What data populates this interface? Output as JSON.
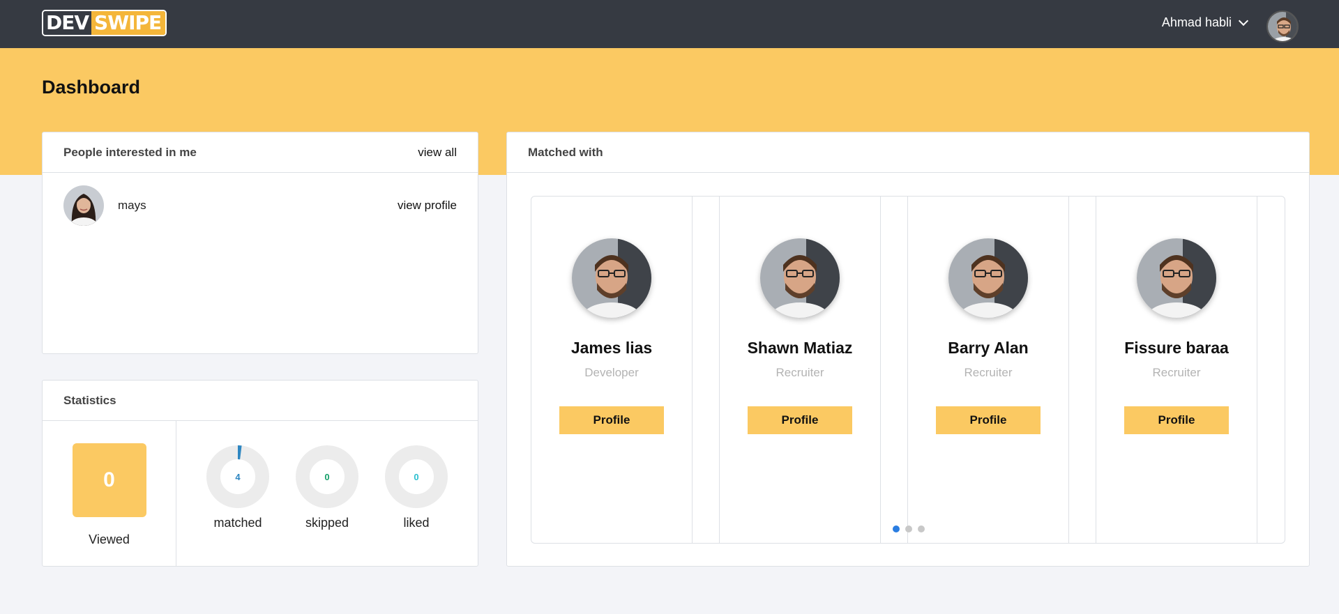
{
  "header": {
    "logo_left": "DEV",
    "logo_right": "SWIPE",
    "user_name": "Ahmad habli"
  },
  "page": {
    "title": "Dashboard"
  },
  "interested": {
    "title": "People interested in me",
    "view_all": "view all",
    "people": [
      {
        "name": "mays",
        "action": "view profile"
      }
    ]
  },
  "statistics": {
    "title": "Statistics",
    "viewed": {
      "value": "0",
      "label": "Viewed"
    },
    "donuts": [
      {
        "value": "4",
        "label": "matched",
        "color": "#2e86c1",
        "fraction": 0.02
      },
      {
        "value": "0",
        "label": "skipped",
        "color": "#16a06a",
        "fraction": 0
      },
      {
        "value": "0",
        "label": "liked",
        "color": "#2bbfcf",
        "fraction": 0
      }
    ]
  },
  "matched": {
    "title": "Matched with",
    "people": [
      {
        "name": "James lias",
        "role": "Developer",
        "button": "Profile"
      },
      {
        "name": "Shawn Matiaz",
        "role": "Recruiter",
        "button": "Profile"
      },
      {
        "name": "Barry Alan",
        "role": "Recruiter",
        "button": "Profile"
      },
      {
        "name": "Fissure baraa",
        "role": "Recruiter",
        "button": "Profile"
      }
    ],
    "active_page": 1,
    "page_count": 3
  },
  "colors": {
    "topbar": "#363a42",
    "accent": "#fbc962",
    "dot_active": "#2a7de1"
  }
}
